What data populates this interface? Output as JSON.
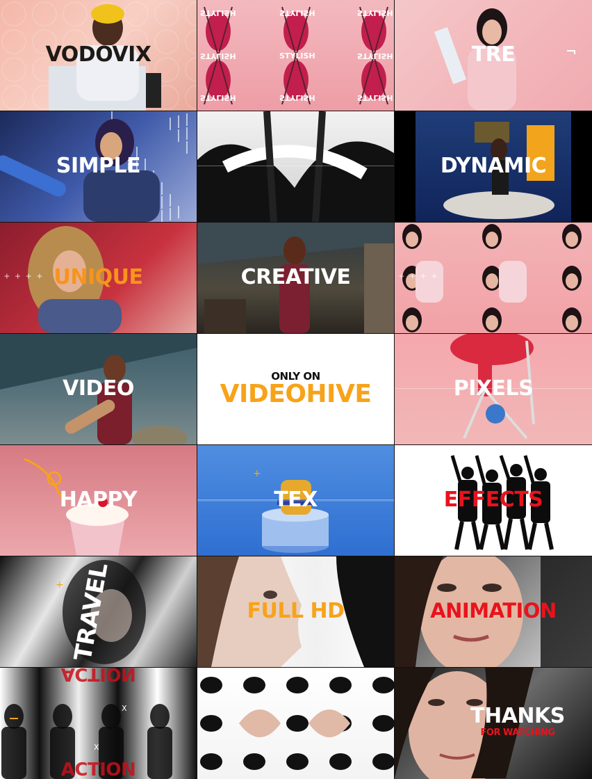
{
  "grid": {
    "columns": 3,
    "rows": 7,
    "tiles": [
      {
        "caption": "VODOVIX",
        "caption_color": "#1d1a16",
        "bg": "linear-gradient(135deg,#f4b7a8 0%,#f8cfc4 50%,#e9a99a 100%)",
        "pattern": "hex",
        "figure": "person-yellow-hat"
      },
      {
        "caption": "STYLISH",
        "caption_color": "#ffffff",
        "bg": "linear-gradient(180deg,#f3b9bf,#ee9da6)",
        "pattern": "mirror",
        "figure": "mirror-women",
        "caption_style": "small-repeat"
      },
      {
        "caption": "TRE",
        "caption_color": "#ffffff",
        "bg": "linear-gradient(135deg,#f5c7c8,#f0aab0)",
        "figure": "woman-pink"
      },
      {
        "caption": "SIMPLE",
        "caption_color": "#ffffff",
        "bg": "linear-gradient(135deg,#1c2a5c,#405baa 50%,#9aa9d8)",
        "figure": "woman-blue"
      },
      {
        "caption": "",
        "caption_color": "#ffffff",
        "bg": "linear-gradient(180deg,#f2f2f2,#cfcfcf)",
        "figure": "abstract-bw"
      },
      {
        "caption": "DYNAMIC",
        "caption_color": "#ffffff",
        "bg": "linear-gradient(180deg,#203d78,#10245a)",
        "figure": "woman-room"
      },
      {
        "caption": "UNIQUE",
        "caption_color": "#f7941d",
        "bg": "linear-gradient(135deg,#8c1d2e,#c8323f 60%,#e3a6a0)",
        "figure": "woman-curly"
      },
      {
        "caption": "CREATIVE",
        "caption_color": "#ffffff",
        "bg": "linear-gradient(180deg,#2d3840,#4f4a3d 60%,#2a2520)",
        "figure": "woman-attic"
      },
      {
        "caption": "",
        "caption_color": "#ffffff",
        "bg": "linear-gradient(180deg,#f3b3b6,#f1a2a6)",
        "figure": "mirror-women-2"
      },
      {
        "caption": "VIDEO",
        "caption_color": "#ffffff",
        "bg": "linear-gradient(180deg,#3b5c68,#56717a 50%,#7d8d8f)",
        "figure": "man-guitar"
      },
      {
        "caption": "VIDEOHIVE",
        "caption_color": "#f7a31a",
        "bg": "#ffffff",
        "figure": "only-on",
        "pre_caption": "ONLY ON",
        "pre_caption_color": "#111111"
      },
      {
        "caption": "PIXELS",
        "caption_color": "#ffffff",
        "bg": "linear-gradient(180deg,#f5a8ad,#f1b7b6)",
        "figure": "bike"
      },
      {
        "caption": "HAPPY",
        "caption_color": "#ffffff",
        "bg": "linear-gradient(180deg,#d67a83,#eba8ad)",
        "figure": "milkshake"
      },
      {
        "caption": "TEX",
        "caption_color": "#ffffff",
        "bg": "linear-gradient(180deg,#4f8ee0,#2f6fd1)",
        "figure": "burger"
      },
      {
        "caption": "EFFECTS",
        "caption_color": "#e8131c",
        "bg": "#ffffff",
        "figure": "dancers"
      },
      {
        "caption": "TRAVEL",
        "caption_color": "#ffffff",
        "bg": "linear-gradient(120deg,#111,#e6e6e6 30%,#222 55%,#d0d0d0 75%,#222)",
        "figure": "blur-woman",
        "caption_rotate": true
      },
      {
        "caption": "FULL HD",
        "caption_color": "#f7a31a",
        "bg": "linear-gradient(90deg,#ffffff,#f0f0f0 60%,#ffffff)",
        "figure": "face-profile",
        "pattern": "hex-light"
      },
      {
        "caption": "ANIMATION",
        "caption_color": "#e8131c",
        "bg": "linear-gradient(135deg,#222,#777 40%,#ddd)",
        "figure": "face-woman"
      },
      {
        "caption": "ACTION",
        "caption_color": "#c8101a",
        "bg": "linear-gradient(90deg,#fff,#111 20%,#eee 40%,#111 60%,#fff 80%,#111)",
        "figure": "action-blur",
        "caption_style": "action"
      },
      {
        "caption": "",
        "caption_color": "#ffffff",
        "bg": "linear-gradient(180deg,#ffffff,#f3f3f3)",
        "figure": "kaleido"
      },
      {
        "caption": "THANKS",
        "caption_color": "#ffffff",
        "bg": "linear-gradient(135deg,#1a1a1a,#6a6a6a 50%,#111)",
        "figure": "face-woman-2",
        "sub_caption": "FOR WATCHING",
        "sub_caption_color": "#e8131c"
      }
    ]
  }
}
